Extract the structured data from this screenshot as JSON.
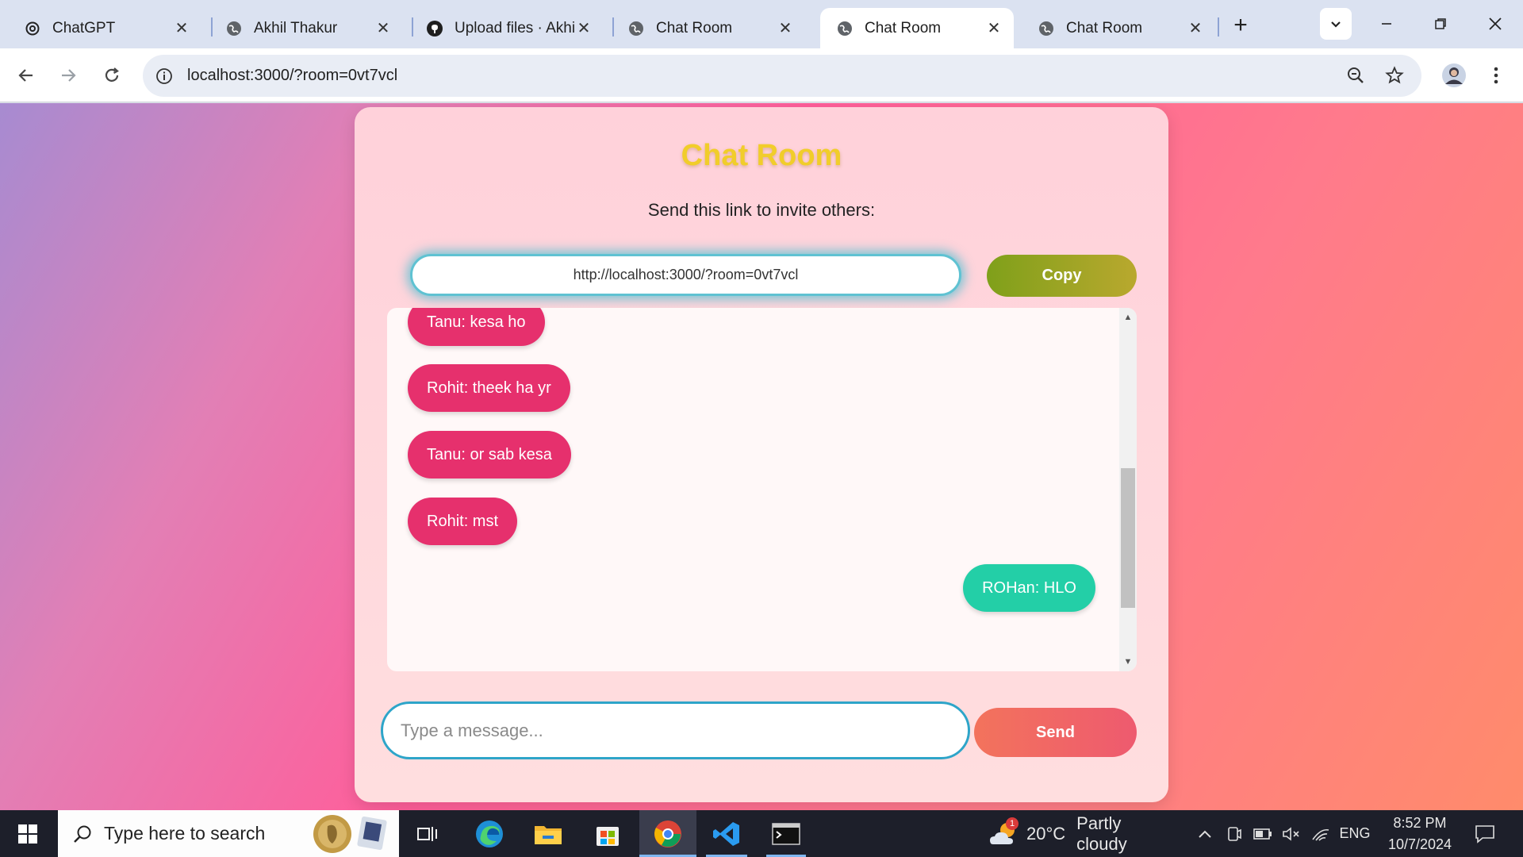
{
  "browser": {
    "tabs": [
      {
        "title": "ChatGPT",
        "icon": "chatgpt-icon",
        "active": false
      },
      {
        "title": "Akhil Thakur",
        "icon": "globe-icon",
        "active": false
      },
      {
        "title": "Upload files · Akhil",
        "icon": "github-icon",
        "active": false
      },
      {
        "title": "Chat Room",
        "icon": "globe-icon",
        "active": false
      },
      {
        "title": "Chat Room",
        "icon": "globe-icon",
        "active": true
      },
      {
        "title": "Chat Room",
        "icon": "globe-icon",
        "active": false
      }
    ],
    "address": "localhost:3000/?room=0vt7vcl"
  },
  "chat_app": {
    "title": "Chat Room",
    "invite_text": "Send this link to invite others:",
    "invite_link": "http://localhost:3000/?room=0vt7vcl",
    "copy_label": "Copy",
    "messages": [
      {
        "text": "Tanu: kesa ho",
        "self": false
      },
      {
        "text": "Rohit: theek ha yr",
        "self": false
      },
      {
        "text": "Tanu: or sab kesa",
        "self": false
      },
      {
        "text": "Rohit: mst",
        "self": false
      },
      {
        "text": "ROHan: HLO",
        "self": true
      }
    ],
    "input_placeholder": "Type a message...",
    "send_label": "Send",
    "colors": {
      "other_bubble": "#e6306d",
      "self_bubble": "#23cfa7",
      "title": "#f1cd2a"
    }
  },
  "taskbar": {
    "search_placeholder": "Type here to search",
    "weather_temp": "20°C",
    "weather_text": "Partly cloudy",
    "weather_badge": "1",
    "language": "ENG",
    "time": "8:52 PM",
    "date": "10/7/2024"
  }
}
